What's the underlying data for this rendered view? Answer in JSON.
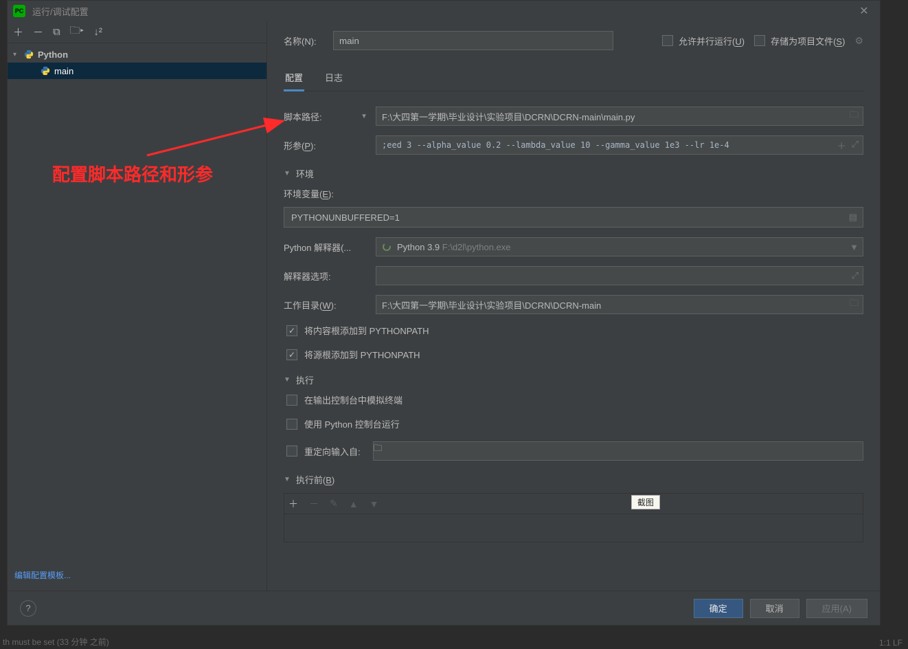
{
  "window": {
    "title": "运行/调试配置"
  },
  "tree": {
    "root_label": "Python",
    "item_label": "main"
  },
  "name": {
    "label": "名称(N):",
    "value": "main"
  },
  "options": {
    "allow_parallel": "允许并行运行(U)",
    "store_as_project_file": "存储为项目文件(S)"
  },
  "tabs": {
    "config": "配置",
    "logs": "日志"
  },
  "fields": {
    "script_path_label": "脚本路径:",
    "script_path_value": "F:\\大四第一学期\\毕业设计\\实验项目\\DCRN\\DCRN-main\\main.py",
    "params_label": "形参(P):",
    "params_value": ";eed 3 --alpha_value 0.2 --lambda_value 10 --gamma_value 1e3 --lr 1e-4",
    "env_section": "环境",
    "env_vars_label": "环境变量(E):",
    "env_vars_value": "PYTHONUNBUFFERED=1",
    "interpreter_label": "Python 解释器(...",
    "interpreter_name": "Python 3.9",
    "interpreter_path": "F:\\d2l\\python.exe",
    "interpreter_opts_label": "解释器选项:",
    "workdir_label": "工作目录(W):",
    "workdir_value": "F:\\大四第一学期\\毕业设计\\实验项目\\DCRN\\DCRN-main",
    "add_content_root": "将内容根添加到 PYTHONPATH",
    "add_source_root": "将源根添加到 PYTHONPATH",
    "exec_section": "执行",
    "emulate_terminal": "在输出控制台中模拟终端",
    "run_with_console": "使用 Python 控制台运行",
    "redirect_input": "重定向输入自:",
    "before_section": "执行前(B)"
  },
  "tooltip": "截图",
  "footer_link": "编辑配置模板...",
  "buttons": {
    "ok": "确定",
    "cancel": "取消",
    "apply": "应用(A)"
  },
  "annotation": "配置脚本路径和形参",
  "status_left": "th must be set (33 分钟 之前)",
  "status_right": "1:1   LF"
}
